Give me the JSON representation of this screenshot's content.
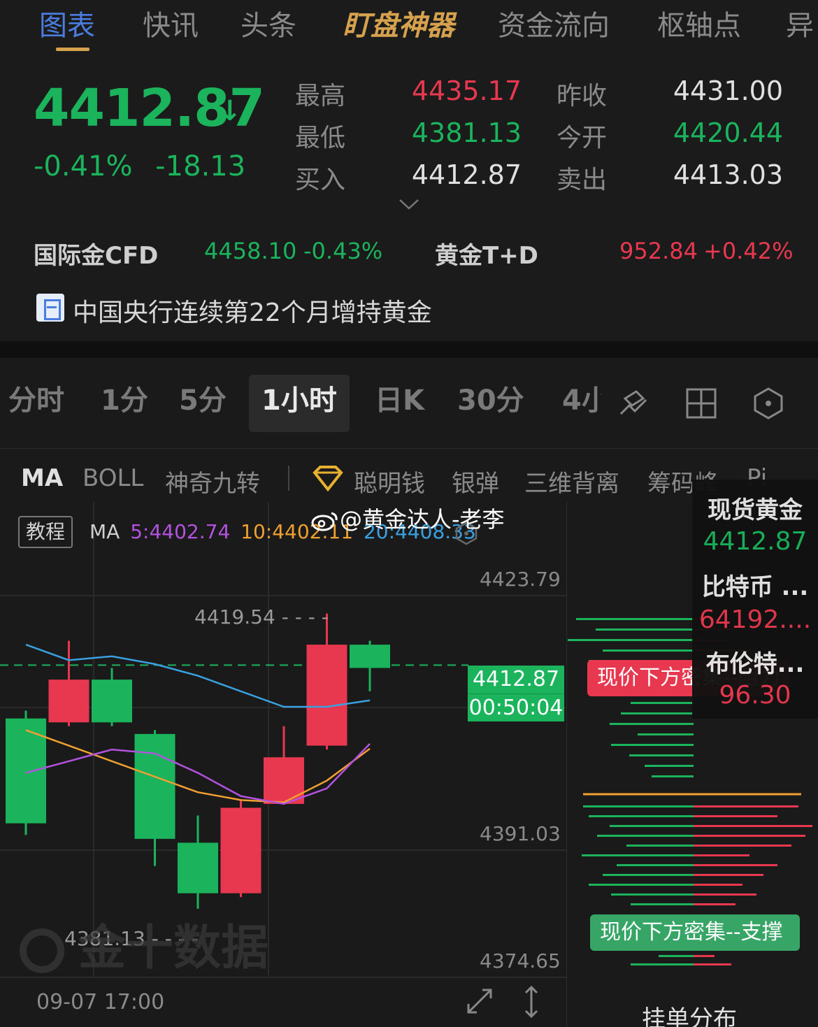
{
  "tabs": [
    "图表",
    "快讯",
    "头条",
    "盯盘神器",
    "资金流向",
    "枢轴点",
    "异"
  ],
  "quote": {
    "price": "4412.87",
    "change_pct": "-0.41%",
    "change_abs": "-18.13",
    "stats": [
      {
        "label": "最高",
        "value": "4435.17",
        "color": "red"
      },
      {
        "label": "昨收",
        "value": "4431.00",
        "color": "white"
      },
      {
        "label": "最低",
        "value": "4381.13",
        "color": "green"
      },
      {
        "label": "今开",
        "value": "4420.44",
        "color": "green"
      },
      {
        "label": "买入",
        "value": "4412.87",
        "color": "white"
      },
      {
        "label": "卖出",
        "value": "4413.03",
        "color": "white"
      }
    ]
  },
  "related": [
    {
      "name": "国际金CFD",
      "price": "4458.10",
      "chg": "-0.43%",
      "color": "green"
    },
    {
      "name": "黄金T+D",
      "price": "952.84",
      "chg": "+0.42%",
      "color": "red"
    }
  ],
  "news": {
    "headline": "中国央行连续第22个月增持黄金"
  },
  "periods": [
    "分时",
    "1分",
    "5分",
    "1小时",
    "日K",
    "30分",
    "4小"
  ],
  "active_period": "1小时",
  "indicators": [
    "MA",
    "BOLL",
    "神奇九转",
    "聪明钱",
    "银弹",
    "三维背离",
    "筹码峰",
    "Pi"
  ],
  "tutorial_label": "教程",
  "ma_legend": {
    "label": "MA",
    "ma5": "5:4402.74",
    "ma10": "10:4402.11",
    "ma20": "20:4408.33"
  },
  "colors": {
    "up": "#e8384f",
    "down": "#1bb35c",
    "ma5": "#b452e0",
    "ma10": "#f0a030",
    "ma20": "#3aa0e0",
    "accent": "#4a7de0"
  },
  "watermark_text": "@黄金达人-老李",
  "brand_watermark": "金十数据",
  "chart_data": {
    "type": "candlestick",
    "y_axis_labels": [
      "4423.79",
      "4391.03",
      "4374.65"
    ],
    "ylim": [
      4374.65,
      4423.79
    ],
    "high_marker": "4419.54",
    "low_marker": "4381.13",
    "current_price": "4412.87",
    "countdown": "00:50:04",
    "x_label": "09-07 17:00",
    "candles": [
      {
        "o": 4406.0,
        "h": 4407.0,
        "l": 4391.0,
        "c": 4392.5
      },
      {
        "o": 4405.5,
        "h": 4416.0,
        "l": 4405.0,
        "c": 4411.0
      },
      {
        "o": 4411.0,
        "h": 4412.5,
        "l": 4405.0,
        "c": 4405.5
      },
      {
        "o": 4404.0,
        "h": 4404.5,
        "l": 4387.0,
        "c": 4390.5
      },
      {
        "o": 4390.0,
        "h": 4393.5,
        "l": 4381.5,
        "c": 4383.5
      },
      {
        "o": 4383.5,
        "h": 4395.5,
        "l": 4383.0,
        "c": 4394.5
      },
      {
        "o": 4395.0,
        "h": 4405.0,
        "l": 4395.0,
        "c": 4401.0
      },
      {
        "o": 4402.5,
        "h": 4419.5,
        "l": 4402.0,
        "c": 4415.5
      },
      {
        "o": 4415.5,
        "h": 4416.0,
        "l": 4409.5,
        "c": 4412.5
      }
    ],
    "ma5": [
      4399.0,
      4400.5,
      4402.0,
      4401.5,
      4399.0,
      4396.0,
      4395.0,
      4397.0,
      4402.74
    ],
    "ma10": [
      4404.5,
      4402.5,
      4400.5,
      4398.5,
      4396.5,
      4395.5,
      4395.2,
      4398.0,
      4402.11
    ],
    "ma20": [
      4415.5,
      4413.5,
      4414.0,
      4413.0,
      4411.5,
      4409.5,
      4407.5,
      4407.5,
      4408.33
    ]
  },
  "side_panel": [
    {
      "name": "现货黄金",
      "value": "4412.87",
      "color": "green"
    },
    {
      "name": "比特币 ...",
      "value": "64192....",
      "color": "red"
    },
    {
      "name": "布伦特...",
      "value": "96.30",
      "color": "red"
    }
  ],
  "order_book": {
    "resistance_label": "现价下方密集--阻力",
    "support_label": "现价下方密集--支撑",
    "title": "挂单分布"
  }
}
